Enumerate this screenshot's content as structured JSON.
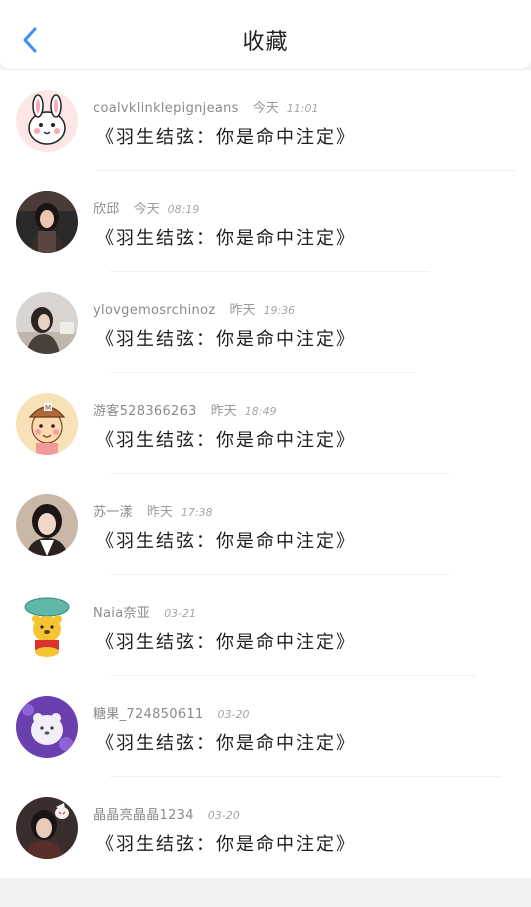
{
  "header": {
    "title": "收藏",
    "back_icon": "chevron-left-icon",
    "accent_color": "#3a8ef6"
  },
  "items": [
    {
      "name": "coalvklinklepignjeans",
      "day": "今天",
      "time": "11:01",
      "content": "《羽生结弦：你是命中注定》",
      "avatar_icon": "cartoon-rabbit-avatar"
    },
    {
      "name": "欣邱",
      "day": "今天",
      "time": "08:19",
      "content": "《羽生结弦：你是命中注定》",
      "avatar_icon": "woman-photo-avatar"
    },
    {
      "name": "ylovgemosrchinoz",
      "day": "昨天",
      "time": "19:36",
      "content": "《羽生结弦：你是命中注定》",
      "avatar_icon": "girl-photo-avatar"
    },
    {
      "name": "游客528366263",
      "day": "昨天",
      "time": "18:49",
      "content": "《羽生结弦：你是命中注定》",
      "avatar_icon": "cartoon-boy-avatar"
    },
    {
      "name": "苏一漾",
      "day": "昨天",
      "time": "17:38",
      "content": "《羽生结弦：你是命中注定》",
      "avatar_icon": "woman-portrait-avatar"
    },
    {
      "name": "Naia奈亚",
      "day": "",
      "time": "03-21",
      "content": "《羽生结弦：你是命中注定》",
      "avatar_icon": "winnie-pooh-avatar"
    },
    {
      "name": "糖果_724850611",
      "day": "",
      "time": "03-20",
      "content": "《羽生结弦：你是命中注定》",
      "avatar_icon": "plush-toy-avatar"
    },
    {
      "name": "晶晶亮晶晶1234",
      "day": "",
      "time": "03-20",
      "content": "《羽生结弦：你是命中注定》",
      "avatar_icon": "person-fox-mask-avatar"
    }
  ]
}
